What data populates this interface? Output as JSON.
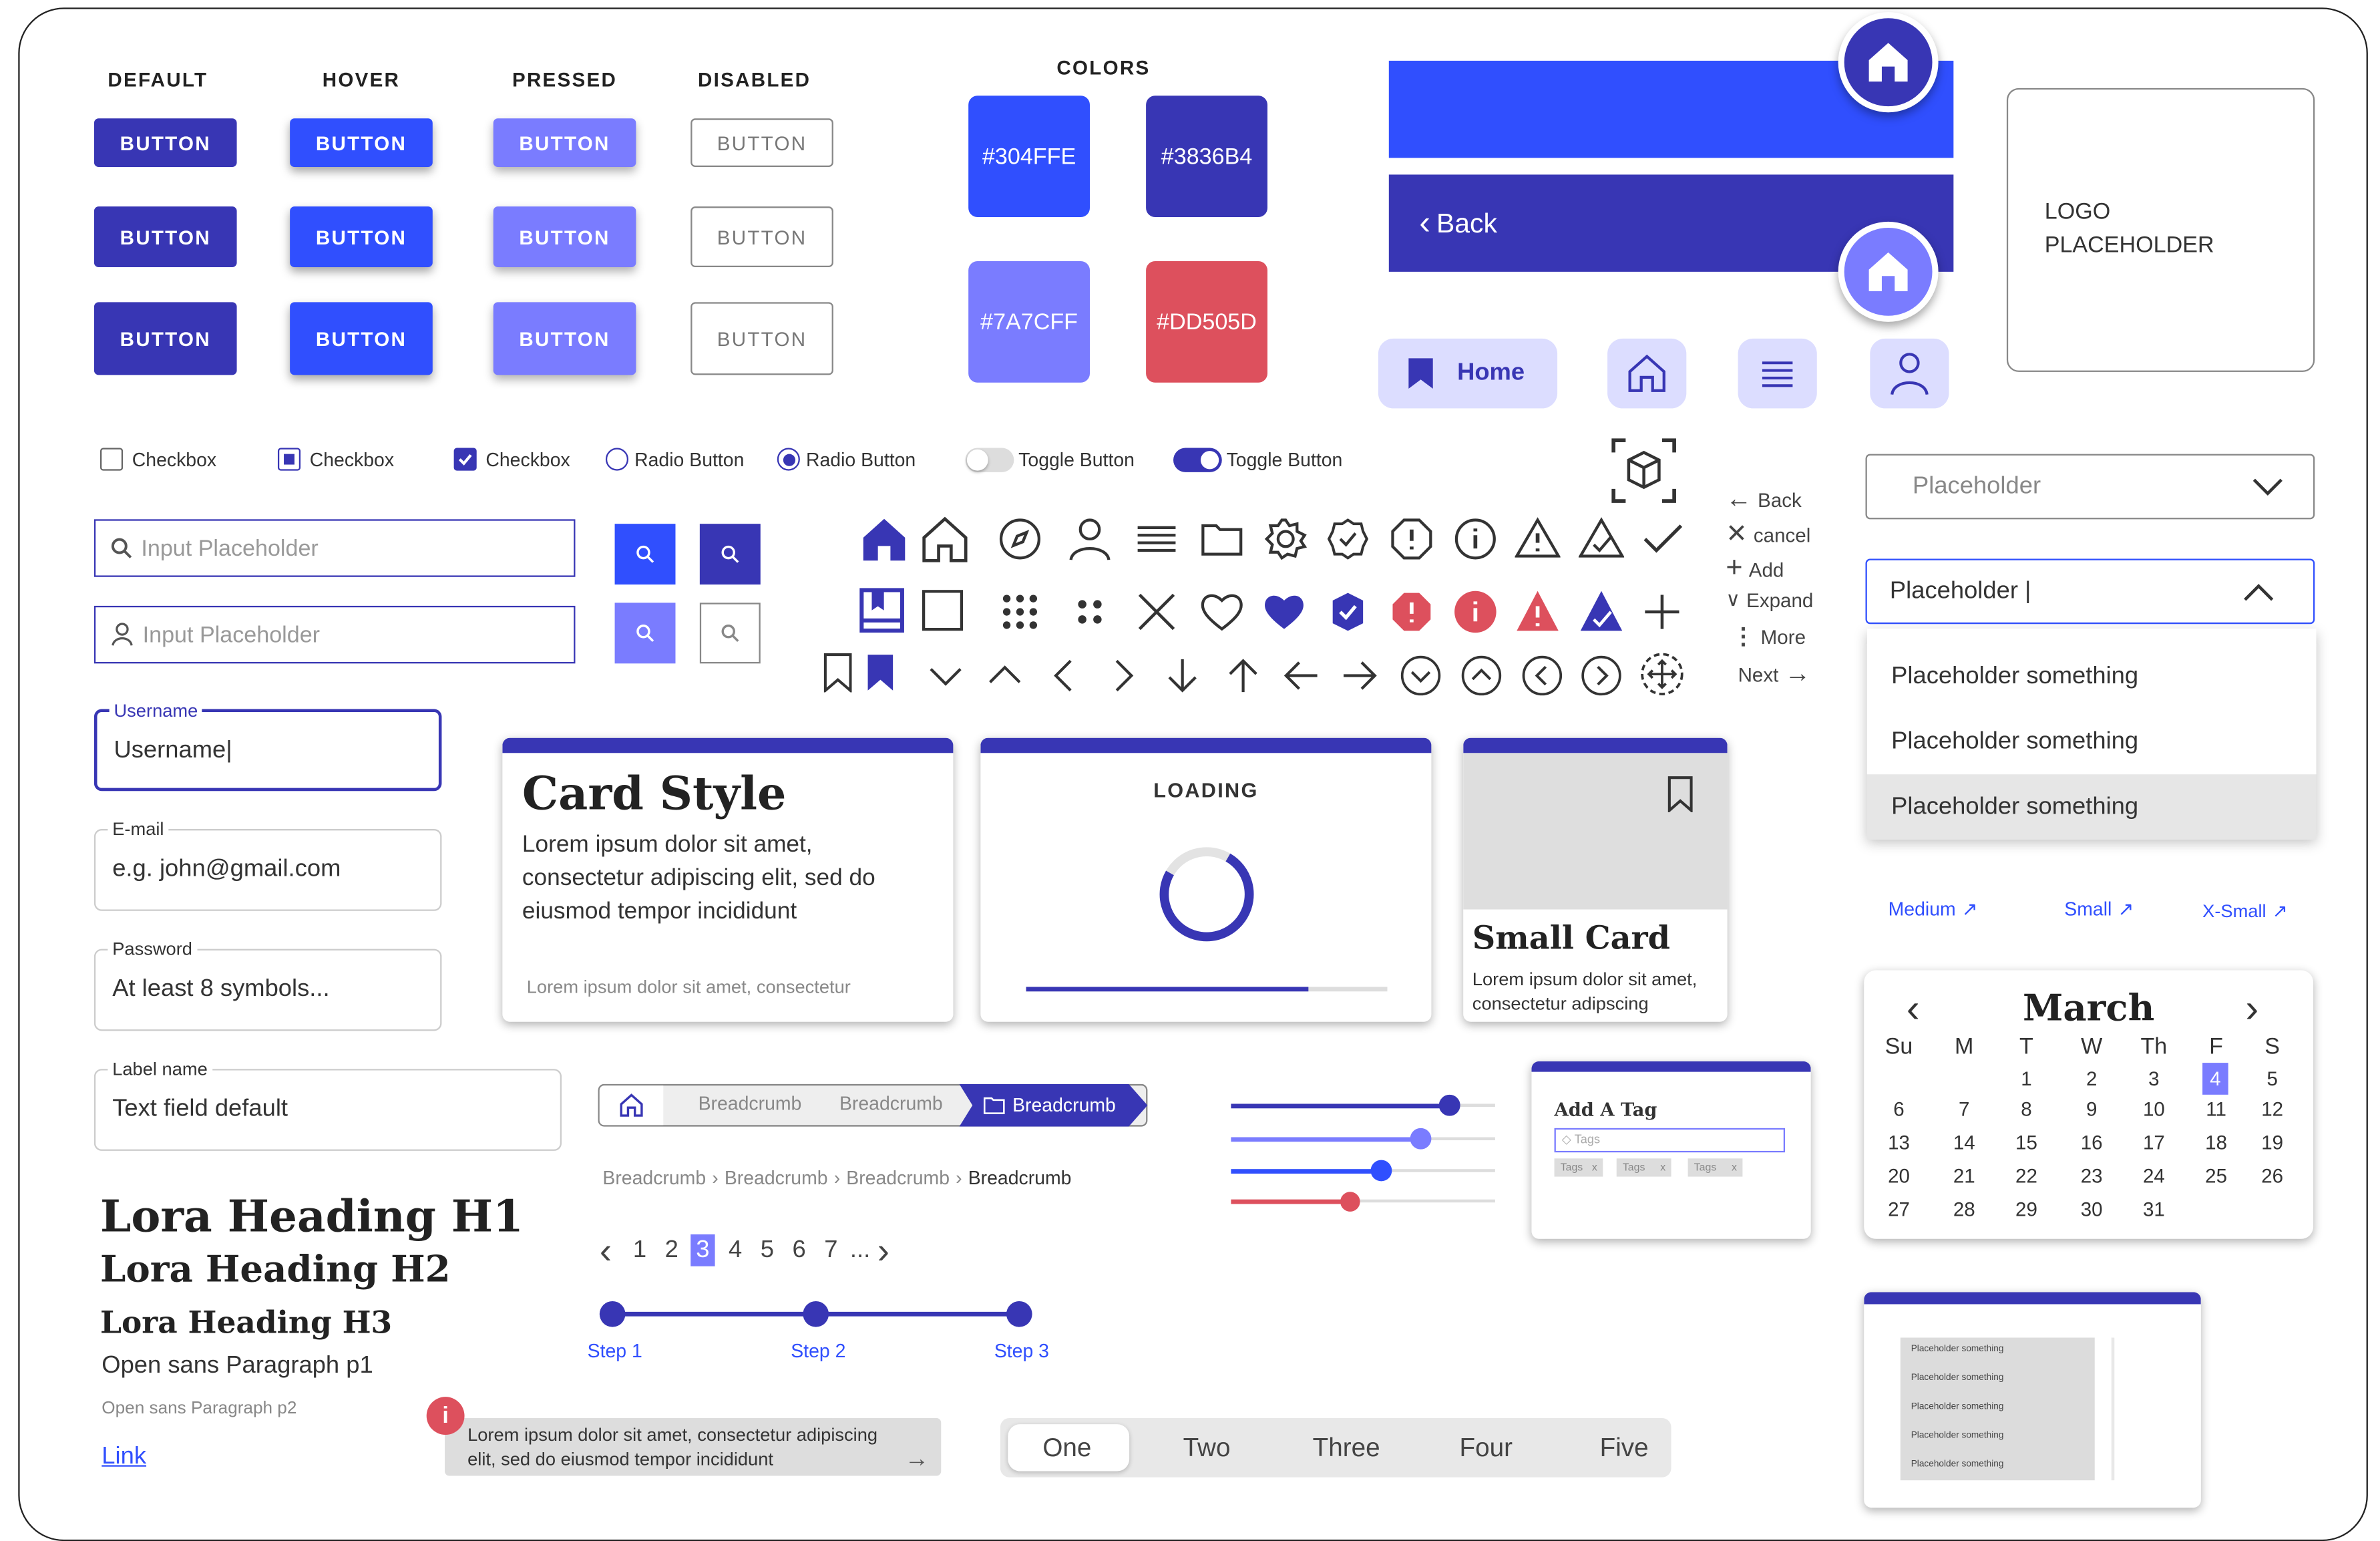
{
  "buttons": {
    "headers": [
      "DEFAULT",
      "HOVER",
      "PRESSED",
      "DISABLED"
    ],
    "label": "BUTTON"
  },
  "colors": {
    "title": "COLORS",
    "swatches": [
      "#304FFE",
      "#3836B4",
      "#7A7CFF",
      "#DD505D"
    ]
  },
  "appbar": {
    "back_label": "Back"
  },
  "logo": {
    "text": "LOGO\nPLACEHOLDER"
  },
  "bottom_nav": {
    "home_label": "Home"
  },
  "controls": {
    "checkbox_label": "Checkbox",
    "radio_label": "Radio Button",
    "toggle_label": "Toggle Button"
  },
  "search": {
    "placeholder": "Input Placeholder"
  },
  "form": {
    "username": {
      "label": "Username",
      "value": "Username"
    },
    "email": {
      "label": "E-mail",
      "value": "e.g. john@gmail.com"
    },
    "password": {
      "label": "Password",
      "value": "At least 8 symbols..."
    },
    "textfield": {
      "label": "Label name",
      "value": "Text field default"
    }
  },
  "icons_side": {
    "back": "Back",
    "cancel": "cancel",
    "add": "Add",
    "expand": "Expand",
    "more": "More",
    "next": "Next"
  },
  "dropdown": {
    "closed_placeholder": "Placeholder",
    "open_value": "Placeholder",
    "options": [
      "Placeholder something",
      "Placeholder something",
      "Placeholder something"
    ]
  },
  "links": [
    "Medium",
    "Small",
    "X-Small"
  ],
  "cards": {
    "style": {
      "title": "Card Style",
      "body": "Lorem ipsum dolor sit amet, consectetur adipiscing elit, sed do eiusmod tempor incididunt",
      "footer": "Lorem ipsum dolor sit amet, consectetur"
    },
    "loading": {
      "title": "LOADING",
      "spinner_fraction": 0.75,
      "bar_fraction": 0.78
    },
    "small": {
      "title": "Small Card",
      "body": "Lorem ipsum dolor sit amet, consectetur adipscing"
    }
  },
  "calendar": {
    "month": "March",
    "weekdays": [
      "Su",
      "M",
      "T",
      "W",
      "Th",
      "F",
      "S"
    ],
    "selected": 4,
    "first_weekday_index": 2,
    "days_in_month": 31
  },
  "typography": {
    "h1": "Lora Heading H1",
    "h2": "Lora Heading H2",
    "h3": "Lora Heading H3",
    "p1": "Open sans Paragraph p1",
    "p2": "Open sans Paragraph p2",
    "link": "Link"
  },
  "breadcrumb": {
    "item": "Breadcrumb",
    "text_items": [
      "Breadcrumb",
      "Breadcrumb",
      "Breadcrumb",
      "Breadcrumb"
    ]
  },
  "pagination": {
    "pages": [
      "1",
      "2",
      "3",
      "4",
      "5",
      "6",
      "7",
      "..."
    ],
    "active": "3"
  },
  "stepper": {
    "steps": [
      "Step 1",
      "Step 2",
      "Step 3"
    ]
  },
  "sliders": {
    "levels": [
      0.83,
      0.72,
      0.57,
      0.45
    ]
  },
  "tags": {
    "title": "Add A Tag",
    "input_placeholder": "Tags",
    "chips": [
      "Tags",
      "Tags",
      "Tags"
    ]
  },
  "alert": {
    "text": "Lorem ipsum dolor sit amet, consectetur adipiscing elit, sed do eiusmod tempor incididunt"
  },
  "segmented": {
    "items": [
      "One",
      "Two",
      "Three",
      "Four",
      "Five"
    ],
    "active": "One"
  },
  "list_card": {
    "items": [
      "Placeholder something",
      "Placeholder something",
      "Placeholder something",
      "Placeholder something",
      "Placeholder something"
    ]
  },
  "palette": {
    "primary": "#304FFE",
    "dark": "#3836B4",
    "light": "#7A7CFF",
    "danger": "#DD505D"
  }
}
